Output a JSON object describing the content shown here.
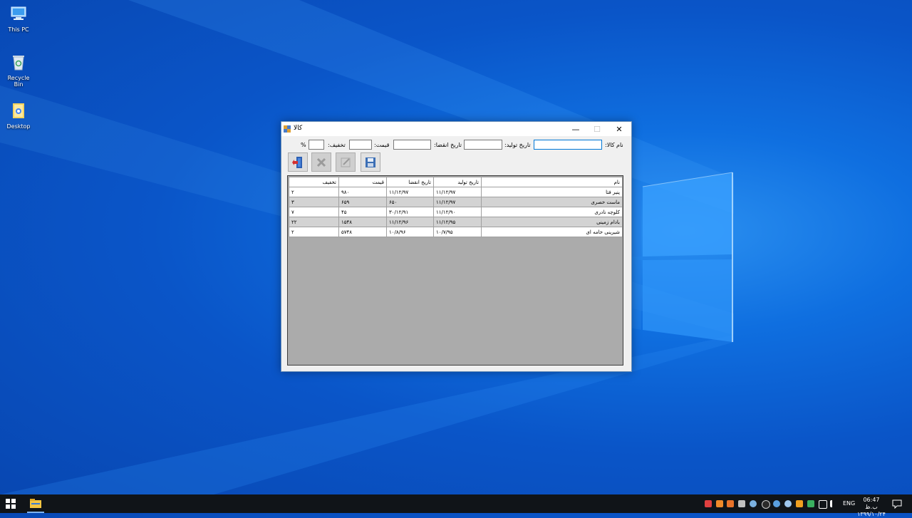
{
  "desktop": {
    "icons": [
      {
        "label": "This PC",
        "icon": "computer-icon"
      },
      {
        "label": "Recycle Bin",
        "icon": "recycle-bin-icon"
      },
      {
        "label": "Desktop",
        "icon": "folder-icon"
      }
    ]
  },
  "window": {
    "title": "کالا",
    "controls": {
      "minimize": "—",
      "maximize": "☐",
      "close": "✕"
    },
    "form": {
      "name_label": "نام کالا:",
      "production_label": "تاریخ تولید:",
      "expiry_label": "تاریخ انقضا:",
      "price_label": "قیمت:",
      "discount_label": "تخفیف:",
      "percent_sign": "%",
      "name_value": "",
      "production_value": "",
      "expiry_value": "",
      "price_value": "",
      "discount_value": ""
    },
    "toolbar": {
      "exit": "exit-door-icon",
      "delete": "delete-x-icon",
      "edit": "edit-pencil-icon",
      "save": "save-floppy-icon"
    },
    "grid": {
      "columns": [
        "نام",
        "تاریخ تولید",
        "تاریخ انقضا",
        "قیمت",
        "تخفیف"
      ],
      "rows": [
        [
          "پنیر فتا",
          "۱۱/۱۲/۹۷",
          "۱۱/۱۲/۹۷",
          "۹۸۰",
          "۲"
        ],
        [
          "ماست خصری",
          "۱۱/۱۲/۹۷",
          "۶۵۰",
          "۶۵۹",
          "۳"
        ],
        [
          "کلوچه نادری",
          "۱۱/۱۲/۹۰",
          "۳۰/۱۲/۹۱",
          "۴۵",
          "۷"
        ],
        [
          "بادام زمینی",
          "۱۱/۱۲/۹۵",
          "۱۱/۱۲/۹۶",
          "۱۵۴۸",
          "۲۲"
        ],
        [
          "شیرینی خامه ای",
          "۱۰/۷/۹۵",
          "۱۰/۸/۹۶",
          "۵۷۴۸",
          "۲"
        ]
      ]
    }
  },
  "taskbar": {
    "language": "ENG",
    "time": "06:47 ب.ظ",
    "date": "۱۳۹۹/۱۰/۲۴"
  }
}
